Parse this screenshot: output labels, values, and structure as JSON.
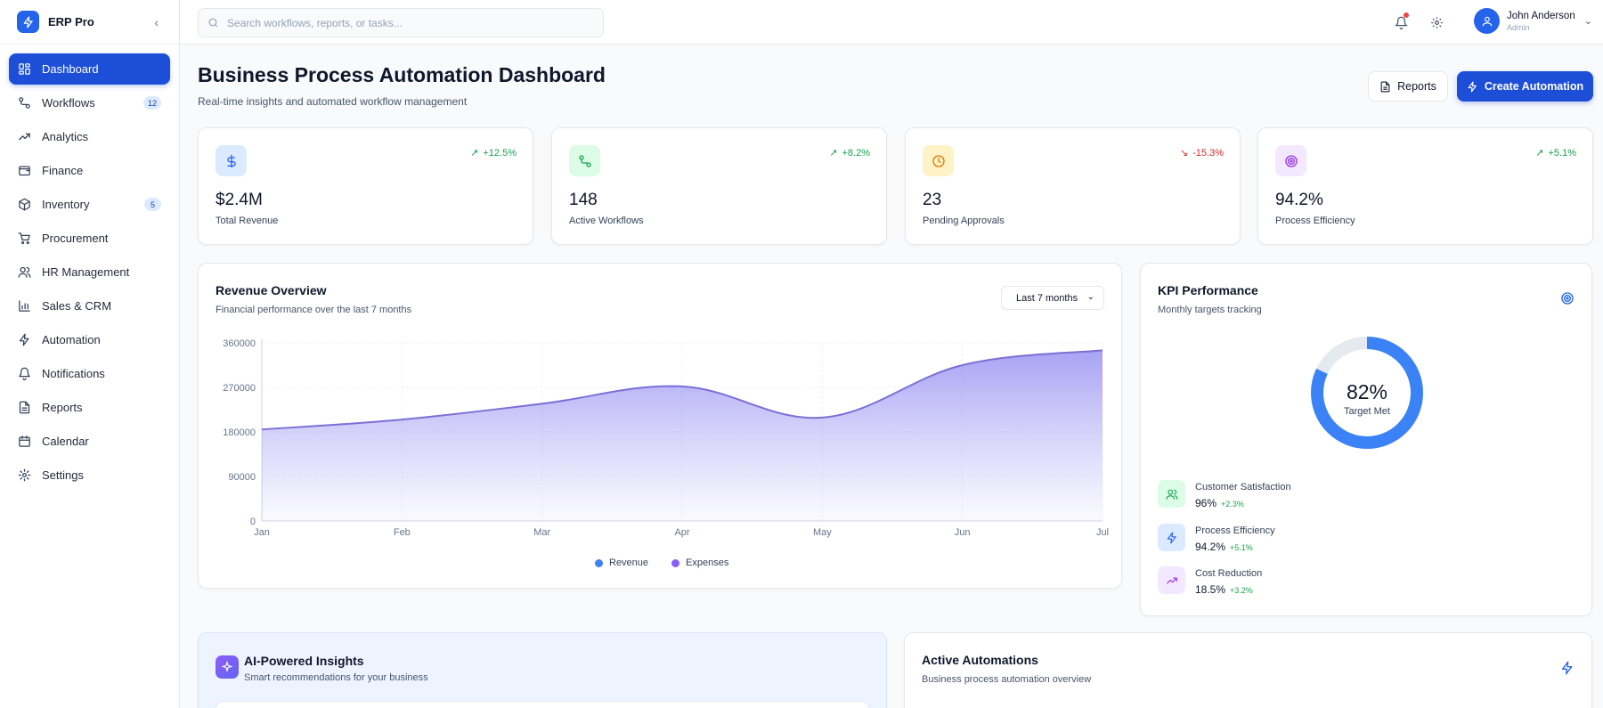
{
  "brand": {
    "name": "ERP Pro"
  },
  "sidebar": {
    "items": [
      {
        "label": "Dashboard",
        "icon": "dashboard-icon",
        "active": true
      },
      {
        "label": "Workflows",
        "icon": "workflow-icon",
        "badge": "12"
      },
      {
        "label": "Analytics",
        "icon": "trending-up-icon"
      },
      {
        "label": "Finance",
        "icon": "wallet-icon"
      },
      {
        "label": "Inventory",
        "icon": "package-icon",
        "badge": "5"
      },
      {
        "label": "Procurement",
        "icon": "cart-icon"
      },
      {
        "label": "HR Management",
        "icon": "users-icon"
      },
      {
        "label": "Sales & CRM",
        "icon": "bar-chart-icon"
      },
      {
        "label": "Automation",
        "icon": "zap-icon"
      },
      {
        "label": "Notifications",
        "icon": "bell-icon"
      },
      {
        "label": "Reports",
        "icon": "file-text-icon"
      },
      {
        "label": "Calendar",
        "icon": "calendar-icon"
      },
      {
        "label": "Settings",
        "icon": "gear-icon"
      }
    ]
  },
  "topbar": {
    "search_placeholder": "Search workflows, reports, or tasks...",
    "user": {
      "name": "John Anderson",
      "role": "Admin"
    }
  },
  "header": {
    "title": "Business Process Automation Dashboard",
    "subtitle": "Real-time insights and automated workflow management",
    "reports_label": "Reports",
    "create_label": "Create Automation"
  },
  "stats": [
    {
      "value": "$2.4M",
      "label": "Total Revenue",
      "trend": "+12.5%",
      "direction": "up",
      "icon": "dollar-icon",
      "icon_color": "#2563eb",
      "icon_bg": "#dbeafe"
    },
    {
      "value": "148",
      "label": "Active Workflows",
      "trend": "+8.2%",
      "direction": "up",
      "icon": "workflow-icon",
      "icon_color": "#16a34a",
      "icon_bg": "#dcfce7"
    },
    {
      "value": "23",
      "label": "Pending Approvals",
      "trend": "-15.3%",
      "direction": "down",
      "icon": "clock-icon",
      "icon_color": "#d97706",
      "icon_bg": "#fef3c7"
    },
    {
      "value": "94.2%",
      "label": "Process Efficiency",
      "trend": "+5.1%",
      "direction": "up",
      "icon": "target-icon",
      "icon_color": "#9333ea",
      "icon_bg": "#f3e8ff"
    }
  ],
  "revenue": {
    "title": "Revenue Overview",
    "subtitle": "Financial performance over the last 7 months",
    "range_selected": "Last 7 months"
  },
  "chart_data": {
    "type": "area",
    "categories": [
      "Jan",
      "Feb",
      "Mar",
      "Apr",
      "May",
      "Jun",
      "Jul"
    ],
    "series": [
      {
        "name": "Expenses",
        "values": [
          185000,
          205000,
          237000,
          272000,
          209000,
          315000,
          345000
        ]
      }
    ],
    "yticks": [
      "360000",
      "270000",
      "180000",
      "90000",
      "0"
    ],
    "ylim": [
      0,
      360000
    ],
    "legend": [
      {
        "name": "Revenue",
        "color": "#3b82f6"
      },
      {
        "name": "Expenses",
        "color": "#8b5cf6"
      }
    ],
    "legend_position": "bottom",
    "grid": true,
    "line_color": "#7c6fd6"
  },
  "kpi": {
    "title": "KPI Performance",
    "subtitle": "Monthly targets tracking",
    "donut_value": 0.82,
    "donut_pct": "82%",
    "donut_label": "Target Met",
    "rows": [
      {
        "name": "Customer Satisfaction",
        "value": "96%",
        "change": "+2.3%",
        "icon": "users-icon",
        "icon_color": "#16a34a",
        "icon_bg": "#dcfce7"
      },
      {
        "name": "Process Efficiency",
        "value": "94.2%",
        "change": "+5.1%",
        "icon": "zap-icon",
        "icon_color": "#2563eb",
        "icon_bg": "#dbeafe"
      },
      {
        "name": "Cost Reduction",
        "value": "18.5%",
        "change": "+3.2%",
        "icon": "trending-up-icon",
        "icon_color": "#9333ea",
        "icon_bg": "#f3e8ff"
      }
    ]
  },
  "insights": {
    "title": "AI-Powered Insights",
    "subtitle": "Smart recommendations for your business"
  },
  "automations": {
    "title": "Active Automations",
    "subtitle": "Business process automation overview"
  }
}
